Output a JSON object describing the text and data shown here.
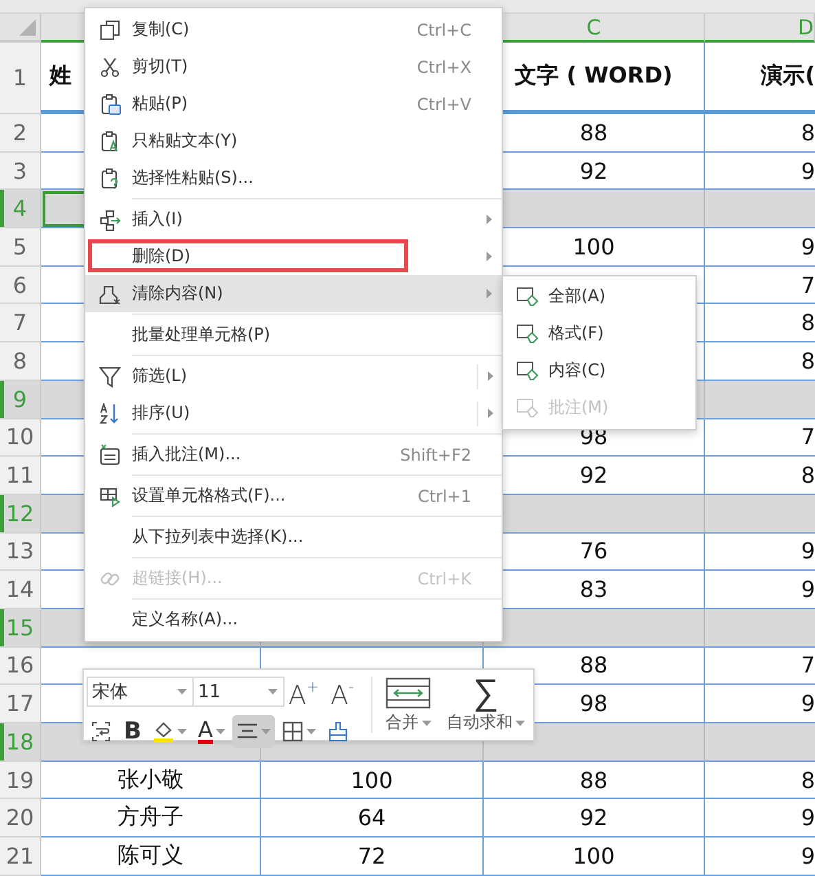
{
  "sheet": {
    "column_headers": [
      "C",
      "D"
    ],
    "rows": [
      {
        "number": "1",
        "kind": "header",
        "selected": false,
        "active_cell": false,
        "cells": [
          "姓",
          null,
          "文字 ( WORD)",
          "演示("
        ]
      },
      {
        "number": "2",
        "kind": "data",
        "selected": false,
        "active_cell": false,
        "cells": [
          null,
          null,
          "88",
          "8"
        ]
      },
      {
        "number": "3",
        "kind": "data",
        "selected": false,
        "active_cell": false,
        "cells": [
          null,
          null,
          "92",
          "9"
        ]
      },
      {
        "number": "4",
        "kind": "data",
        "selected": true,
        "active_cell": true,
        "cells": [
          null,
          null,
          null,
          null
        ]
      },
      {
        "number": "5",
        "kind": "data",
        "selected": false,
        "active_cell": false,
        "cells": [
          null,
          null,
          "100",
          "9"
        ]
      },
      {
        "number": "6",
        "kind": "data",
        "selected": false,
        "active_cell": false,
        "cells": [
          null,
          null,
          null,
          "7"
        ]
      },
      {
        "number": "7",
        "kind": "data",
        "selected": false,
        "active_cell": false,
        "cells": [
          null,
          null,
          null,
          "8"
        ]
      },
      {
        "number": "8",
        "kind": "data",
        "selected": false,
        "active_cell": false,
        "cells": [
          null,
          null,
          null,
          "8"
        ]
      },
      {
        "number": "9",
        "kind": "data",
        "selected": true,
        "active_cell": false,
        "cells": [
          null,
          null,
          null,
          null
        ]
      },
      {
        "number": "10",
        "kind": "data",
        "selected": false,
        "active_cell": false,
        "cells": [
          null,
          null,
          "98",
          "7"
        ]
      },
      {
        "number": "11",
        "kind": "data",
        "selected": false,
        "active_cell": false,
        "cells": [
          null,
          null,
          "92",
          "8"
        ]
      },
      {
        "number": "12",
        "kind": "data",
        "selected": true,
        "active_cell": false,
        "cells": [
          null,
          null,
          null,
          null
        ]
      },
      {
        "number": "13",
        "kind": "data",
        "selected": false,
        "active_cell": false,
        "cells": [
          null,
          null,
          "76",
          "9"
        ]
      },
      {
        "number": "14",
        "kind": "data",
        "selected": false,
        "active_cell": false,
        "cells": [
          null,
          null,
          "83",
          "9"
        ]
      },
      {
        "number": "15",
        "kind": "data",
        "selected": true,
        "active_cell": false,
        "cells": [
          null,
          null,
          null,
          null
        ]
      },
      {
        "number": "16",
        "kind": "data",
        "selected": false,
        "active_cell": false,
        "cells": [
          null,
          null,
          "88",
          "7"
        ]
      },
      {
        "number": "17",
        "kind": "data",
        "selected": false,
        "active_cell": false,
        "cells": [
          null,
          null,
          "98",
          "9"
        ]
      },
      {
        "number": "18",
        "kind": "data",
        "selected": true,
        "active_cell": false,
        "cells": [
          null,
          null,
          null,
          null
        ]
      },
      {
        "number": "19",
        "kind": "data",
        "selected": false,
        "active_cell": false,
        "cells": [
          "张小敬",
          "100",
          "88",
          "8"
        ]
      },
      {
        "number": "20",
        "kind": "data",
        "selected": false,
        "active_cell": false,
        "cells": [
          "方舟子",
          "64",
          "92",
          "9"
        ]
      },
      {
        "number": "21",
        "kind": "data",
        "selected": false,
        "active_cell": false,
        "cells": [
          "陈可义",
          "72",
          "100",
          "9"
        ]
      }
    ]
  },
  "context_menu": {
    "sections": [
      [
        {
          "label": "复制(C)",
          "shortcut": "Ctrl+C",
          "submenu": false,
          "split": false,
          "selected": false,
          "disabled": false,
          "highlighted": false
        },
        {
          "label": "剪切(T)",
          "shortcut": "Ctrl+X",
          "submenu": false,
          "split": false,
          "selected": false,
          "disabled": false,
          "highlighted": false
        },
        {
          "label": "粘贴(P)",
          "shortcut": "Ctrl+V",
          "submenu": false,
          "split": false,
          "selected": false,
          "disabled": false,
          "highlighted": false
        },
        {
          "label": "只粘贴文本(Y)",
          "submenu": false,
          "split": false,
          "selected": false,
          "disabled": false,
          "highlighted": false
        },
        {
          "label": "选择性粘贴(S)...",
          "submenu": false,
          "split": false,
          "selected": false,
          "disabled": false,
          "highlighted": false
        }
      ],
      [
        {
          "label": "插入(I)",
          "submenu": true,
          "split": false,
          "selected": false,
          "disabled": false,
          "highlighted": false
        },
        {
          "label": "删除(D)",
          "submenu": true,
          "split": false,
          "selected": false,
          "disabled": false,
          "highlighted": true
        },
        {
          "label": "清除内容(N)",
          "submenu": true,
          "split": false,
          "selected": true,
          "disabled": false,
          "highlighted": false
        }
      ],
      [
        {
          "label": "批量处理单元格(P)",
          "submenu": false,
          "split": false,
          "selected": false,
          "disabled": false,
          "highlighted": false
        }
      ],
      [
        {
          "label": "筛选(L)",
          "submenu": true,
          "split": true,
          "selected": false,
          "disabled": false,
          "highlighted": false
        },
        {
          "label": "排序(U)",
          "submenu": true,
          "split": true,
          "selected": false,
          "disabled": false,
          "highlighted": false
        }
      ],
      [
        {
          "label": "插入批注(M)...",
          "shortcut": "Shift+F2",
          "submenu": false,
          "split": false,
          "selected": false,
          "disabled": false,
          "highlighted": false
        }
      ],
      [
        {
          "label": "设置单元格格式(F)...",
          "shortcut": "Ctrl+1",
          "submenu": false,
          "split": false,
          "selected": false,
          "disabled": false,
          "highlighted": false
        }
      ],
      [
        {
          "label": "从下拉列表中选择(K)...",
          "submenu": false,
          "split": false,
          "selected": false,
          "disabled": false,
          "highlighted": false
        }
      ],
      [
        {
          "label": "超链接(H)...",
          "shortcut": "Ctrl+K",
          "submenu": false,
          "split": false,
          "selected": false,
          "disabled": true,
          "highlighted": false
        }
      ],
      [
        {
          "label": "定义名称(A)...",
          "submenu": false,
          "split": false,
          "selected": false,
          "disabled": false,
          "highlighted": false
        }
      ]
    ]
  },
  "submenu": {
    "items": [
      {
        "label": "全部(A)",
        "disabled": false
      },
      {
        "label": "格式(F)",
        "disabled": false
      },
      {
        "label": "内容(C)",
        "disabled": false
      },
      {
        "label": "批注(M)",
        "disabled": true
      }
    ]
  },
  "mini_toolbar": {
    "font": "宋体",
    "size": "11",
    "grow_label": "A$^{+}$",
    "shrink_label": "A$^{-}$",
    "tools": [
      {
        "kind": "wrap",
        "selected": false,
        "dropdown": false
      },
      {
        "kind": "bold",
        "label": "B",
        "selected": false,
        "dropdown": false
      },
      {
        "kind": "fill",
        "selected": false,
        "dropdown": true
      },
      {
        "kind": "font_color",
        "label": "A",
        "selected": false,
        "dropdown": true
      },
      {
        "kind": "align",
        "selected": true,
        "dropdown": true
      },
      {
        "kind": "border",
        "selected": false,
        "dropdown": true
      },
      {
        "kind": "painter",
        "selected": false,
        "dropdown": false
      }
    ],
    "actions": [
      {
        "kind": "merge",
        "label": "合并",
        "dropdown": true
      },
      {
        "kind": "sum",
        "symbol": "∑",
        "label": "自动求和",
        "dropdown": true
      }
    ]
  }
}
